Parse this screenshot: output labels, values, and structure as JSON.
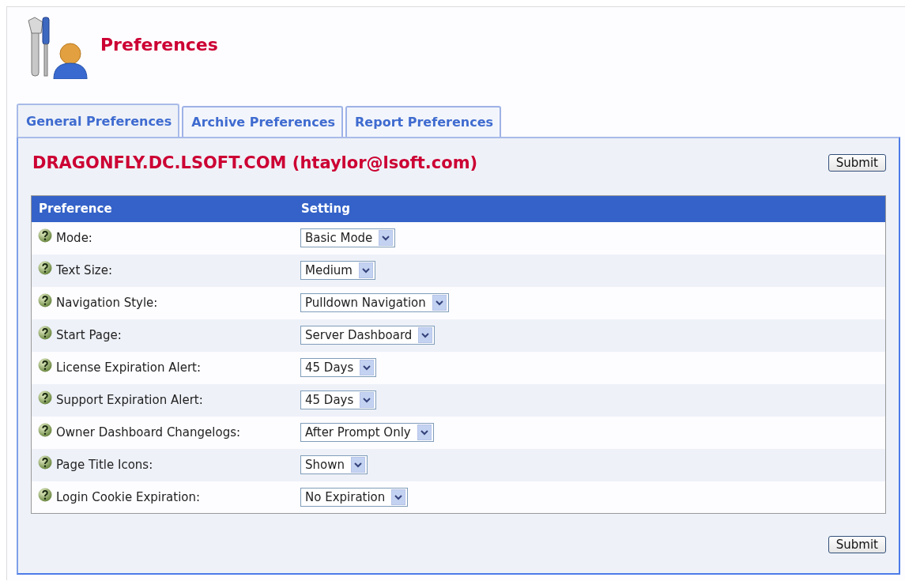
{
  "page": {
    "title": "Preferences"
  },
  "tabs": [
    {
      "label": "General Preferences",
      "selected": true
    },
    {
      "label": "Archive Preferences",
      "selected": false
    },
    {
      "label": "Report Preferences",
      "selected": false
    }
  ],
  "panel": {
    "heading": "DRAGONFLY.DC.LSOFT.COM (htaylor@lsoft.com)",
    "submit_top": "Submit",
    "submit_bottom": "Submit"
  },
  "table": {
    "columns": [
      "Preference",
      "Setting"
    ],
    "rows": [
      {
        "label": "Mode:",
        "value": "Basic Mode"
      },
      {
        "label": "Text Size:",
        "value": "Medium"
      },
      {
        "label": "Navigation Style:",
        "value": "Pulldown Navigation"
      },
      {
        "label": "Start Page:",
        "value": "Server Dashboard"
      },
      {
        "label": "License Expiration Alert:",
        "value": "45 Days"
      },
      {
        "label": "Support Expiration Alert:",
        "value": "45 Days"
      },
      {
        "label": "Owner Dashboard Changelogs:",
        "value": "After Prompt Only"
      },
      {
        "label": "Page Title Icons:",
        "value": "Shown"
      },
      {
        "label": "Login Cookie Expiration:",
        "value": "No Expiration"
      }
    ]
  }
}
